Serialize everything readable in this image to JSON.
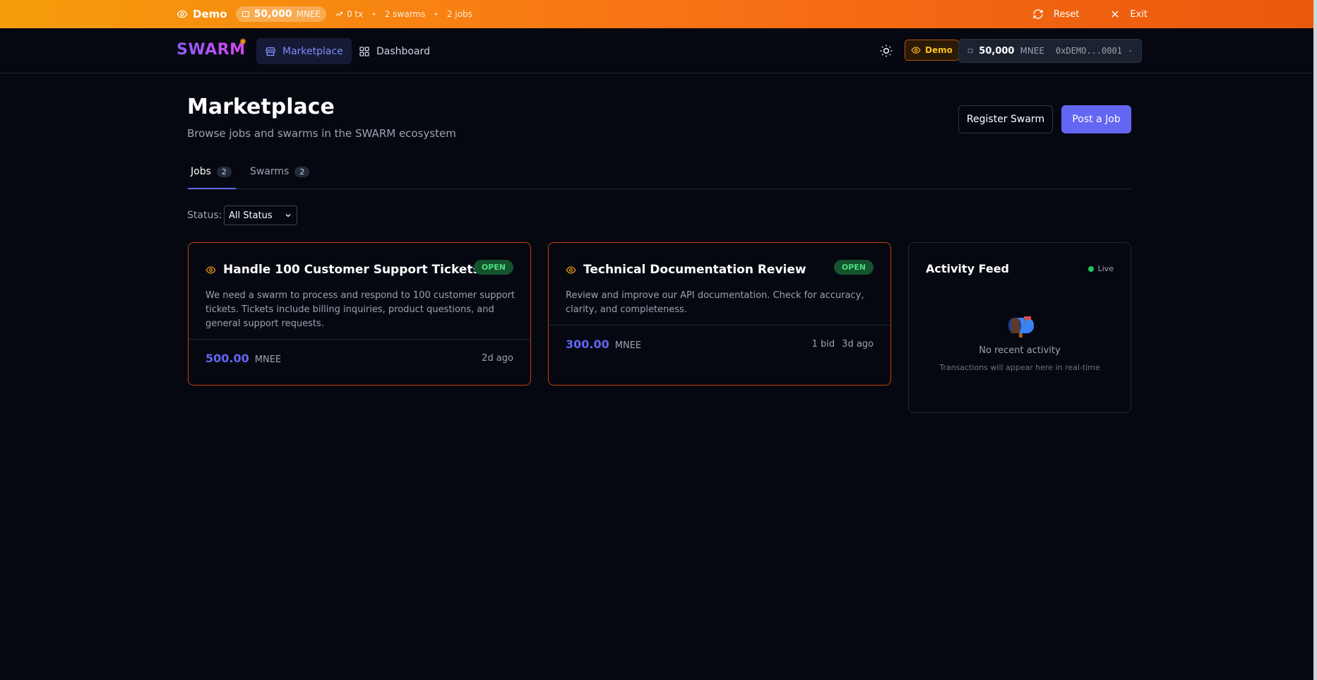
{
  "banner": {
    "demo_label": "Demo",
    "balance": "50,000",
    "balance_unit": "MNEE",
    "tx": "0 tx",
    "swarms": "2 swarms",
    "jobs": "2 jobs",
    "separator": "•",
    "reset_label": "Reset",
    "exit_label": "Exit"
  },
  "nav": {
    "logo": "SWARM",
    "marketplace_label": "Marketplace",
    "dashboard_label": "Dashboard",
    "demo_chip": "Demo",
    "wallet_balance": "50,000",
    "wallet_unit": "MNEE",
    "wallet_address": "0xDEMO...0001"
  },
  "page": {
    "title": "Marketplace",
    "subtitle": "Browse jobs and swarms in the SWARM ecosystem",
    "register_label": "Register Swarm",
    "post_label": "Post a Job"
  },
  "tabs": [
    {
      "label": "Jobs",
      "count": "2"
    },
    {
      "label": "Swarms",
      "count": "2"
    }
  ],
  "filter": {
    "label": "Status:",
    "selected": "All Status"
  },
  "jobs": [
    {
      "title": "Handle 100 Customer Support Tickets",
      "status": "OPEN",
      "description": "We need a swarm to process and respond to 100 customer support tickets. Tickets include billing inquiries, product questions, and general support requests.",
      "price": "500.00",
      "unit": "MNEE",
      "bids": "",
      "age": "2d ago"
    },
    {
      "title": "Technical Documentation Review",
      "status": "OPEN",
      "description": "Review and improve our API documentation. Check for accuracy, clarity, and completeness.",
      "price": "300.00",
      "unit": "MNEE",
      "bids": "1 bid",
      "age": "3d ago"
    }
  ],
  "activity": {
    "title": "Activity Feed",
    "live_label": "Live",
    "empty_title": "No recent activity",
    "empty_sub": "Transactions will appear here in real-time"
  },
  "colors": {
    "accent": "#6366f1",
    "banner_start": "#f59e0b",
    "banner_end": "#ea580c",
    "open_badge": "#4ade80",
    "card_border": "#c2410c"
  }
}
